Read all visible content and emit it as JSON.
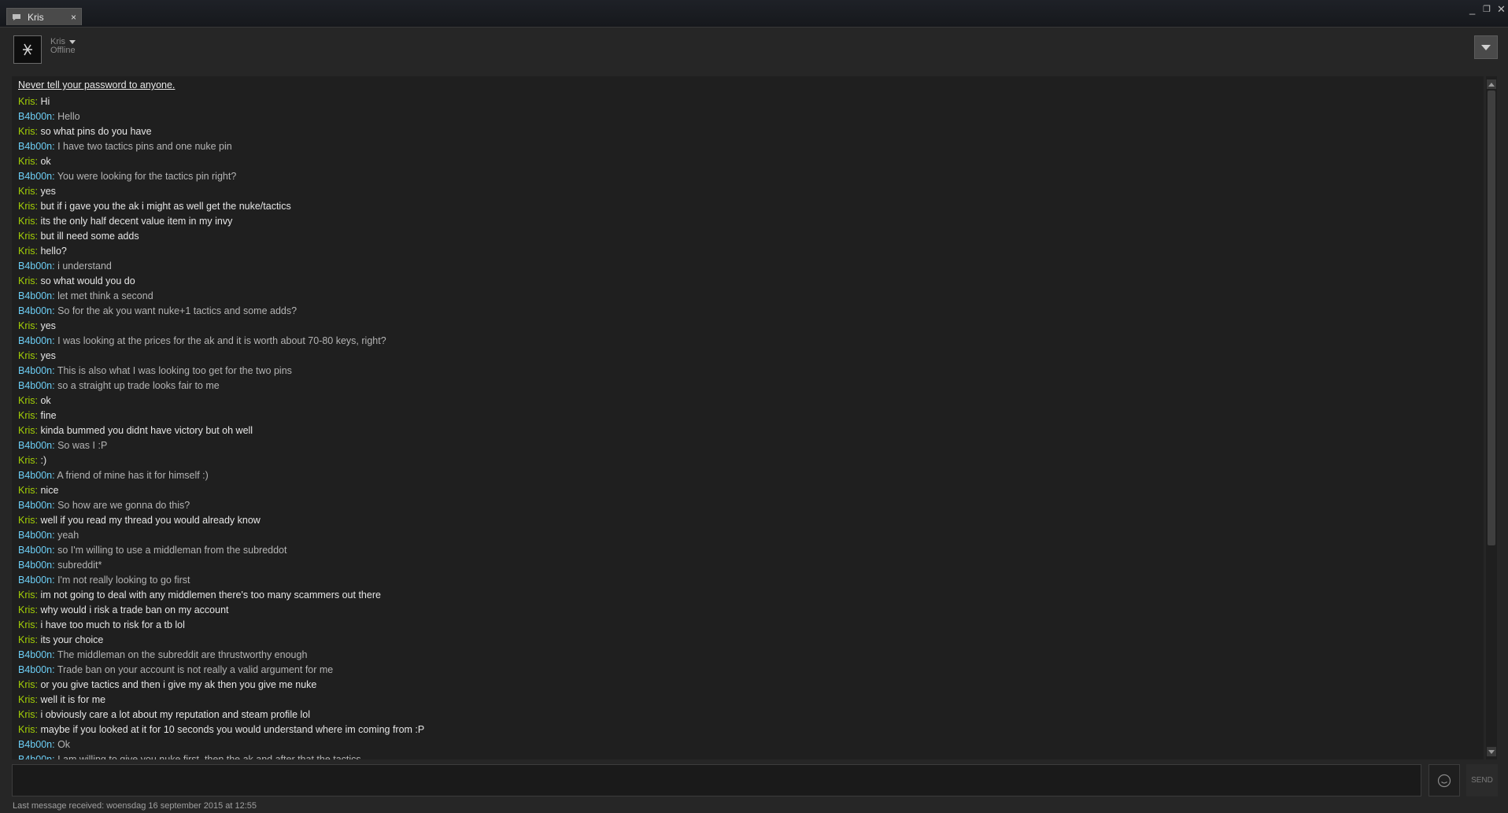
{
  "window": {
    "tab_label": "Kris",
    "tab_close": "×",
    "minimize": "_",
    "maximize": "❐",
    "close": "✕"
  },
  "friend": {
    "name": "Kris",
    "status": "Offline"
  },
  "chat": {
    "warning": "Never tell your password to anyone.",
    "messages": [
      {
        "sender": "Kris",
        "text": "Hi"
      },
      {
        "sender": "B4b00n",
        "text": "Hello"
      },
      {
        "sender": "Kris",
        "text": "so what pins do you have"
      },
      {
        "sender": "B4b00n",
        "text": "I have two tactics pins and one nuke pin"
      },
      {
        "sender": "Kris",
        "text": "ok"
      },
      {
        "sender": "B4b00n",
        "text": "You were looking for the tactics pin right?"
      },
      {
        "sender": "Kris",
        "text": "yes"
      },
      {
        "sender": "Kris",
        "text": "but if i gave you the ak i might as well get the nuke/tactics"
      },
      {
        "sender": "Kris",
        "text": "its the only half decent value item in my invy"
      },
      {
        "sender": "Kris",
        "text": "but ill need some adds"
      },
      {
        "sender": "Kris",
        "text": "hello?"
      },
      {
        "sender": "B4b00n",
        "text": "i understand"
      },
      {
        "sender": "Kris",
        "text": "so what would you do"
      },
      {
        "sender": "B4b00n",
        "text": "let met think a second"
      },
      {
        "sender": "B4b00n",
        "text": "So for the ak you want nuke+1 tactics and some adds?"
      },
      {
        "sender": "Kris",
        "text": "yes"
      },
      {
        "sender": "B4b00n",
        "text": "I was looking at the prices for the ak and it is worth about 70-80 keys, right?"
      },
      {
        "sender": "Kris",
        "text": "yes"
      },
      {
        "sender": "B4b00n",
        "text": "This is also what I was looking too get for the two pins"
      },
      {
        "sender": "B4b00n",
        "text": "so a straight up trade looks fair to me"
      },
      {
        "sender": "Kris",
        "text": "ok"
      },
      {
        "sender": "Kris",
        "text": "fine"
      },
      {
        "sender": "Kris",
        "text": "kinda bummed you didnt have victory but oh well"
      },
      {
        "sender": "B4b00n",
        "text": "So was I :P"
      },
      {
        "sender": "Kris",
        "text": ":)"
      },
      {
        "sender": "B4b00n",
        "text": "A friend of mine has it for himself :)"
      },
      {
        "sender": "Kris",
        "text": "nice"
      },
      {
        "sender": "B4b00n",
        "text": "So how are we gonna do this?"
      },
      {
        "sender": "Kris",
        "text": "well if you read my thread you would already know"
      },
      {
        "sender": "B4b00n",
        "text": "yeah"
      },
      {
        "sender": "B4b00n",
        "text": "so I'm willing to use a middleman from the subreddot"
      },
      {
        "sender": "B4b00n",
        "text": "subreddit*"
      },
      {
        "sender": "B4b00n",
        "text": "I'm not really looking to go first"
      },
      {
        "sender": "Kris",
        "text": "im not going to deal with any middlemen there's too many scammers out there"
      },
      {
        "sender": "Kris",
        "text": "why would i risk a trade ban on my account"
      },
      {
        "sender": "Kris",
        "text": "i have too much to risk for a tb lol"
      },
      {
        "sender": "Kris",
        "text": "its your choice"
      },
      {
        "sender": "B4b00n",
        "text": "The middleman on the subreddit are thrustworthy enough"
      },
      {
        "sender": "B4b00n",
        "text": "Trade ban on your account is not really a valid argument for me"
      },
      {
        "sender": "Kris",
        "text": "or you give tactics and then i give my ak then you give me nuke"
      },
      {
        "sender": "Kris",
        "text": "well it is for me"
      },
      {
        "sender": "Kris",
        "text": "i obviously care a lot about my reputation and steam profile lol"
      },
      {
        "sender": "Kris",
        "text": "maybe if you looked at it for 10 seconds you would understand where im coming from :P"
      },
      {
        "sender": "B4b00n",
        "text": "Ok"
      },
      {
        "sender": "B4b00n",
        "text": "I am willing to give you nuke first, then the ak and after that the tactics"
      }
    ]
  },
  "input": {
    "placeholder": "",
    "send_label": "SEND"
  },
  "footer": {
    "last_message": "Last message received: woensdag 16 september 2015 at 12:55"
  },
  "colors": {
    "kris_name": "#a3cf06",
    "b4b00n_name": "#6dcff6"
  }
}
